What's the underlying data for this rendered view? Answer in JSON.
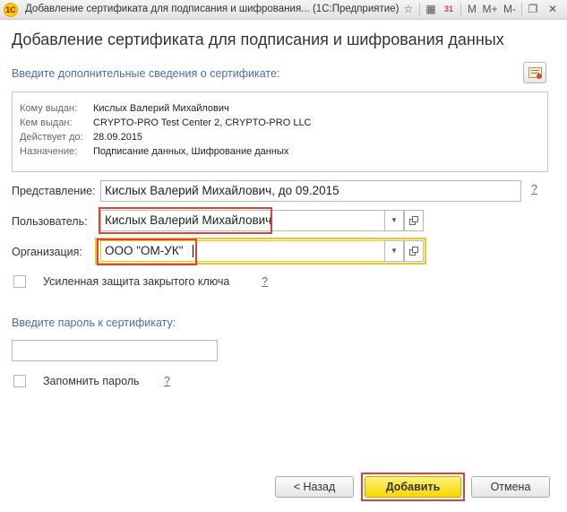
{
  "window": {
    "app_icon": "1c-logo-icon",
    "title": "Добавление сертификата для подписания и шифрования... (1С:Предприятие)"
  },
  "form": {
    "title": "Добавление сертификата для подписания и шифрования данных",
    "section_label": "Введите дополнительные сведения о сертификате:",
    "cert_info": [
      {
        "label": "Кому выдан:",
        "value": "Кислых Валерий Михайлович"
      },
      {
        "label": "Кем выдан:",
        "value": "CRYPTO-PRO Test Center 2, CRYPTO-PRO LLC"
      },
      {
        "label": "Действует до:",
        "value": "28.09.2015"
      },
      {
        "label": "Назначение:",
        "value": "Подписание данных, Шифрование данных"
      }
    ],
    "representation": {
      "label": "Представление:",
      "value": "Кислых Валерий Михайлович, до 09.2015"
    },
    "user": {
      "label": "Пользователь:",
      "value": "Кислых Валерий Михайлович"
    },
    "organization": {
      "label": "Организация:",
      "value": "ООО \"ОМ-УК\""
    },
    "strong_protection_label": "Усиленная защита закрытого ключа",
    "password_label": "Введите пароль к сертификату:",
    "password_value": "",
    "remember_password_label": "Запомнить пароль",
    "help_mark": "?"
  },
  "buttons": {
    "back": "< Назад",
    "add": "Добавить",
    "cancel": "Отмена"
  },
  "colors": {
    "highlight_frame": "#d9443b",
    "focus_frame": "#f0c419",
    "primary_button": "#f7d800",
    "link_blue": "#4a6fa5"
  }
}
